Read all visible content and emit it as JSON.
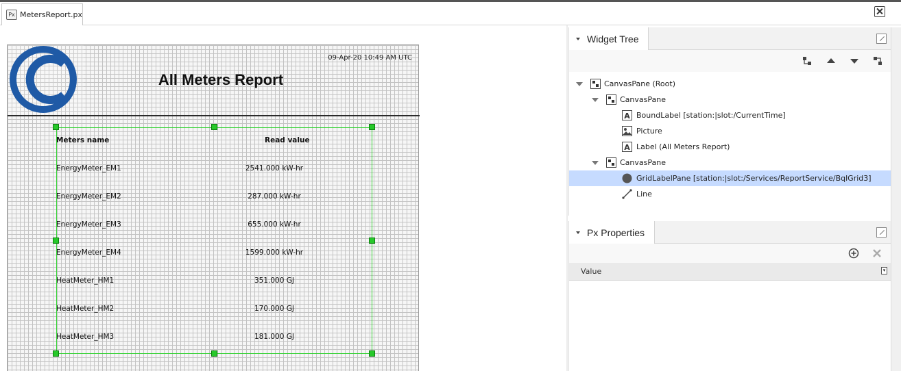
{
  "tab": {
    "icon_text": "Px",
    "label": "MetersReport.px"
  },
  "canvas": {
    "timestamp": "09-Apr-20 10:49 AM UTC",
    "title": "All Meters Report",
    "table": {
      "columns": [
        "Meters name",
        "Read  value"
      ],
      "rows": [
        {
          "name": "EnergyMeter_EM1",
          "value": "2541.000 kW-hr"
        },
        {
          "name": "EnergyMeter_EM2",
          "value": "287.000 kW-hr"
        },
        {
          "name": "EnergyMeter_EM3",
          "value": "655.000 kW-hr"
        },
        {
          "name": "EnergyMeter_EM4",
          "value": "1599.000 kW-hr"
        },
        {
          "name": "HeatMeter_HM1",
          "value": "351.000 GJ"
        },
        {
          "name": "HeatMeter_HM2",
          "value": "170.000 GJ"
        },
        {
          "name": "HeatMeter_HM3",
          "value": "181.000 GJ"
        }
      ]
    },
    "logo_color": "#1f5aa6",
    "grid_selection_color": "#36d336"
  },
  "widget_tree": {
    "title": "Widget Tree",
    "toolbar_icons": [
      "grow-selection-icon",
      "move-up-icon",
      "move-down-icon",
      "shrink-selection-icon"
    ],
    "nodes": [
      {
        "label": "CanvasPane (Root)",
        "icon": "canvas-pane-icon",
        "level": 0,
        "expanded": true,
        "selected": false
      },
      {
        "label": "CanvasPane",
        "icon": "canvas-pane-icon",
        "level": 1,
        "expanded": true,
        "selected": false
      },
      {
        "label": "BoundLabel [station:|slot:/CurrentTime]",
        "icon": "label-icon",
        "level": 2,
        "expanded": false,
        "selected": false
      },
      {
        "label": "Picture",
        "icon": "picture-icon",
        "level": 2,
        "expanded": false,
        "selected": false
      },
      {
        "label": "Label (All Meters Report)",
        "icon": "label-icon",
        "level": 2,
        "expanded": false,
        "selected": false
      },
      {
        "label": "CanvasPane",
        "icon": "canvas-pane-icon",
        "level": 1,
        "expanded": true,
        "selected": false
      },
      {
        "label": "GridLabelPane [station:|slot:/Services/ReportService/BqlGrid3]",
        "icon": "grid-label-pane-icon",
        "level": 2,
        "expanded": false,
        "selected": true
      },
      {
        "label": "Line",
        "icon": "line-icon",
        "level": 2,
        "expanded": false,
        "selected": false
      }
    ],
    "selection_color": "#c6dbff"
  },
  "px_properties": {
    "title": "Px Properties",
    "toolbar_icons": [
      "add-icon",
      "remove-icon"
    ],
    "columns": [
      "Value"
    ],
    "column_menu_icon": "column-chooser-icon"
  }
}
